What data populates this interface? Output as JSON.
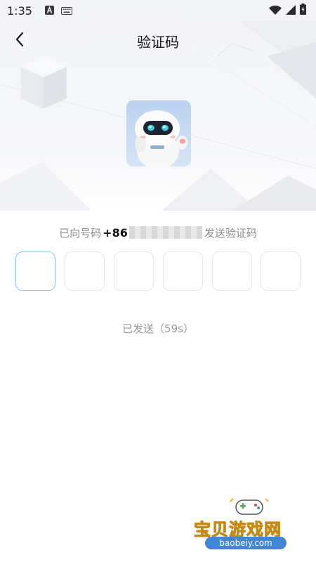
{
  "status_bar": {
    "time": "1:35",
    "icons": [
      "a-badge-icon",
      "keyboard-icon",
      "wifi-icon",
      "signal-icon",
      "battery-icon"
    ]
  },
  "nav": {
    "back_icon": "chevron-left-icon",
    "title": "验证码"
  },
  "avatar": {
    "icon": "robot-mascot"
  },
  "hint": {
    "before": "已向号码",
    "country_code": "+86",
    "after": "发送验证码"
  },
  "code_input": {
    "length": 6,
    "active_index": 0,
    "active_color": "#8cc2f2",
    "border_color": "#e6e6e6"
  },
  "resend": {
    "text": "已发送（59s）"
  },
  "watermark": {
    "title": "宝贝游戏网",
    "url": "baobeiy.com",
    "icon": "gamepad-icon"
  }
}
